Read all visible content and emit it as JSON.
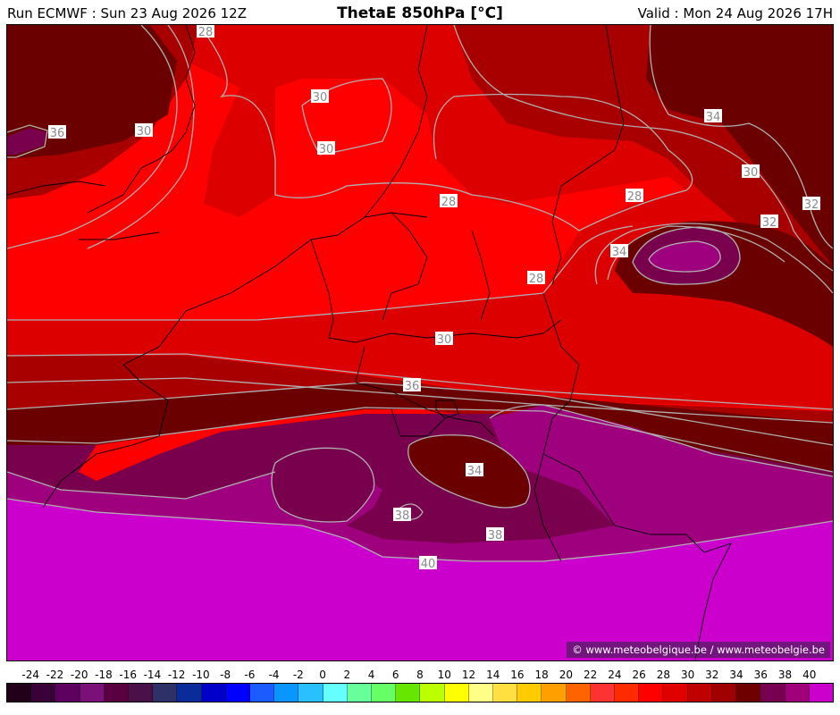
{
  "header": {
    "run": "Run ECMWF : Sun 23 Aug 2026 12Z",
    "title": "ThetaE 850hPa [°C]",
    "valid": "Valid : Mon 24 Aug 2026 17H"
  },
  "credit": "© www.meteobelgique.be / www.meteobelgie.be",
  "contour_labels": [
    "28",
    "30",
    "36",
    "30",
    "30",
    "28",
    "34",
    "30",
    "28",
    "32",
    "32",
    "34",
    "28",
    "30",
    "36",
    "34",
    "38",
    "38",
    "40"
  ],
  "colors": {
    "c28": "#ff0000",
    "c30": "#dd0000",
    "c32": "#a80000",
    "c34": "#6a0000",
    "c36": "#78004c",
    "c38": "#9e007e",
    "c40": "#cc00cc",
    "isoline": "#b0b0b0",
    "border": "#000000"
  },
  "scale": {
    "labels": [
      "-24",
      "-22",
      "-20",
      "-18",
      "-16",
      "-14",
      "-12",
      "-10",
      "-8",
      "-6",
      "-4",
      "-2",
      "0",
      "2",
      "4",
      "6",
      "8",
      "10",
      "12",
      "14",
      "16",
      "18",
      "20",
      "22",
      "24",
      "26",
      "28",
      "30",
      "32",
      "34",
      "36",
      "38",
      "40"
    ],
    "colors": [
      "#22001a",
      "#3a0038",
      "#5e0060",
      "#7a1078",
      "#5a0040",
      "#4a1048",
      "#2e3068",
      "#0a2c9a",
      "#0000c8",
      "#0000ff",
      "#1a5cff",
      "#0a96ff",
      "#28c0ff",
      "#66ffff",
      "#66ff99",
      "#66ff66",
      "#66e600",
      "#bbff00",
      "#ffff00",
      "#ffff88",
      "#ffe040",
      "#ffcc00",
      "#ffa000",
      "#ff6400",
      "#ff3232",
      "#ff2a00",
      "#ff0000",
      "#e00000",
      "#c00000",
      "#a00000",
      "#6e0000",
      "#780050",
      "#a0007a",
      "#cc00cc"
    ]
  }
}
